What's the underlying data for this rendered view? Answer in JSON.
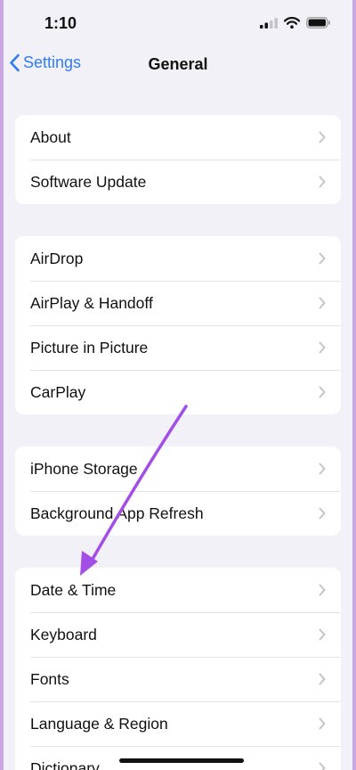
{
  "status_bar": {
    "time": "1:10"
  },
  "nav": {
    "back_label": "Settings",
    "title": "General"
  },
  "groups": [
    {
      "items": [
        {
          "label": "About"
        },
        {
          "label": "Software Update"
        }
      ]
    },
    {
      "items": [
        {
          "label": "AirDrop"
        },
        {
          "label": "AirPlay & Handoff"
        },
        {
          "label": "Picture in Picture"
        },
        {
          "label": "CarPlay"
        }
      ]
    },
    {
      "items": [
        {
          "label": "iPhone Storage"
        },
        {
          "label": "Background App Refresh"
        }
      ]
    },
    {
      "items": [
        {
          "label": "Date & Time"
        },
        {
          "label": "Keyboard"
        },
        {
          "label": "Fonts"
        },
        {
          "label": "Language & Region"
        },
        {
          "label": "Dictionary"
        }
      ]
    }
  ],
  "colors": {
    "accent": "#2f7cf6",
    "annotation": "#a44ee8",
    "background": "#f2f1f7"
  },
  "icons": [
    "signal-bars-icon",
    "wifi-icon",
    "battery-icon",
    "chevron-left-icon",
    "chevron-right-icon"
  ]
}
